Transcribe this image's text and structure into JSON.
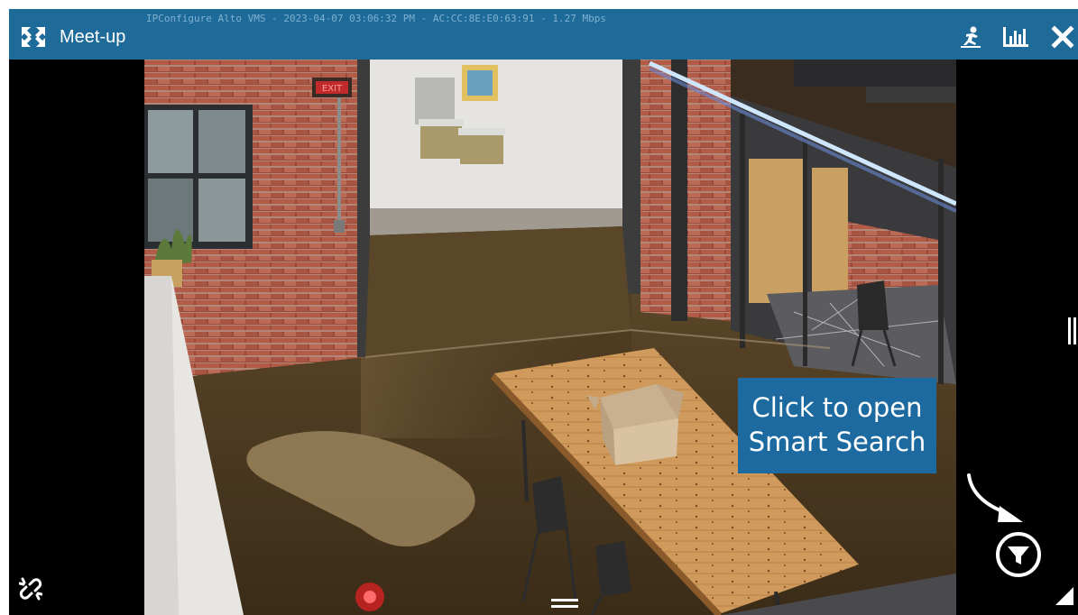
{
  "header": {
    "camera_name": "Meet-up",
    "overlay_text": "IPConfigure Alto VMS - 2023-04-07 03:06:32 PM - AC:CC:8E:E0:63:91 -  1.27 Mbps",
    "icons": [
      "expand-icon",
      "person-icon",
      "stats-icon",
      "close-icon"
    ]
  },
  "video": {
    "sign_text": "EXIT"
  },
  "callout": {
    "line1": "Click to open",
    "line2": "Smart Search"
  },
  "controls": {
    "smart_search_icon": "filter-icon",
    "link_icon": "broken-link-icon",
    "menu_icon": "menu-icon",
    "resize_icon": "resize-corner-icon"
  },
  "colors": {
    "header_bg": "#1e6a98",
    "callout_bg": "#1c6aa0",
    "overlay_text": "#7fb1d2"
  }
}
